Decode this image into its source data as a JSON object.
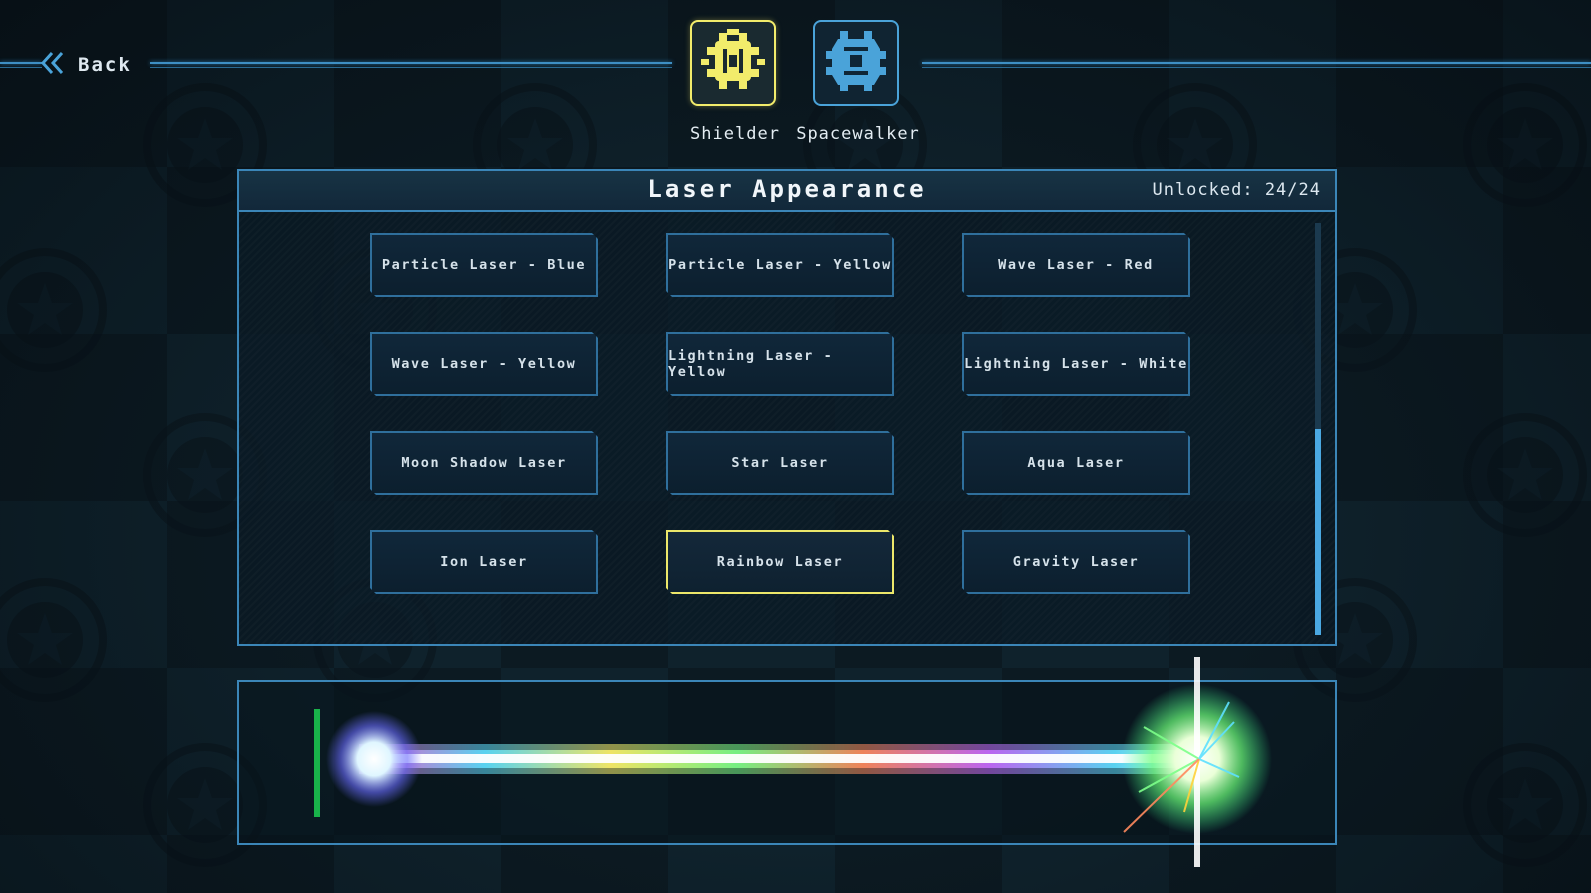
{
  "back": {
    "label": "Back"
  },
  "characters": [
    {
      "name": "Shielder",
      "selected": true,
      "icon": "shielder-ship-icon"
    },
    {
      "name": "Spacewalker",
      "selected": false,
      "icon": "spacewalker-ship-icon"
    }
  ],
  "panel": {
    "title": "Laser Appearance",
    "unlocked": "Unlocked: 24/24"
  },
  "lasers": [
    {
      "label": "Particle Laser - Blue"
    },
    {
      "label": "Particle Laser - Yellow"
    },
    {
      "label": "Wave Laser - Red"
    },
    {
      "label": "Wave Laser - Yellow"
    },
    {
      "label": "Lightning Laser - Yellow"
    },
    {
      "label": "Lightning Laser - White"
    },
    {
      "label": "Moon Shadow Laser"
    },
    {
      "label": "Star Laser"
    },
    {
      "label": "Aqua Laser"
    },
    {
      "label": "Ion Laser"
    },
    {
      "label": "Rainbow Laser",
      "selected": true
    },
    {
      "label": "Gravity Laser"
    }
  ],
  "scroll": {
    "position": 0.5,
    "visible_fraction": 0.5
  },
  "colors": {
    "accent": "#3b86b8",
    "selected": "#ece76a",
    "shielder": "#f2ec6b",
    "spacewalker": "#4aa3d9"
  }
}
